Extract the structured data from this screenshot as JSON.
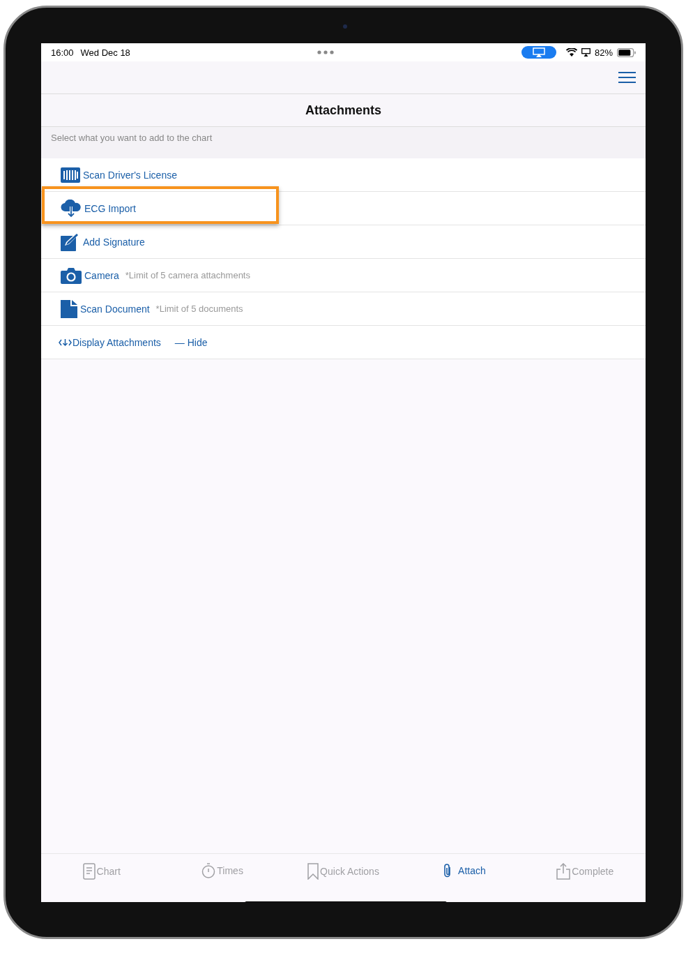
{
  "status_bar": {
    "time": "16:00",
    "date": "Wed Dec 18",
    "battery": "82%"
  },
  "header": {
    "title": "Attachments",
    "instruction": "Select what you want to add to the chart"
  },
  "items": [
    {
      "kind": "license",
      "label": "Scan Driver's License",
      "highlighted": false
    },
    {
      "kind": "cloud",
      "label": "ECG Import",
      "highlighted": true
    },
    {
      "kind": "signature",
      "label": "Add Signature",
      "highlighted": false
    },
    {
      "kind": "camera",
      "label": "Camera",
      "note": "*Limit of 5 camera attachments",
      "highlighted": false
    },
    {
      "kind": "document",
      "label": "Scan Document",
      "note": "*Limit of 5 documents",
      "highlighted": false
    }
  ],
  "display_row": {
    "label": "Display Attachments",
    "toggle": "— Hide"
  },
  "tabs": [
    {
      "kind": "chart",
      "label": "Chart",
      "selected": false
    },
    {
      "kind": "timer",
      "label": "Times",
      "selected": false
    },
    {
      "kind": "bookmark",
      "label": "Quick Actions",
      "selected": false
    },
    {
      "kind": "paperclip",
      "label": "Attach",
      "selected": true
    },
    {
      "kind": "share",
      "label": "Complete",
      "selected": false
    }
  ]
}
